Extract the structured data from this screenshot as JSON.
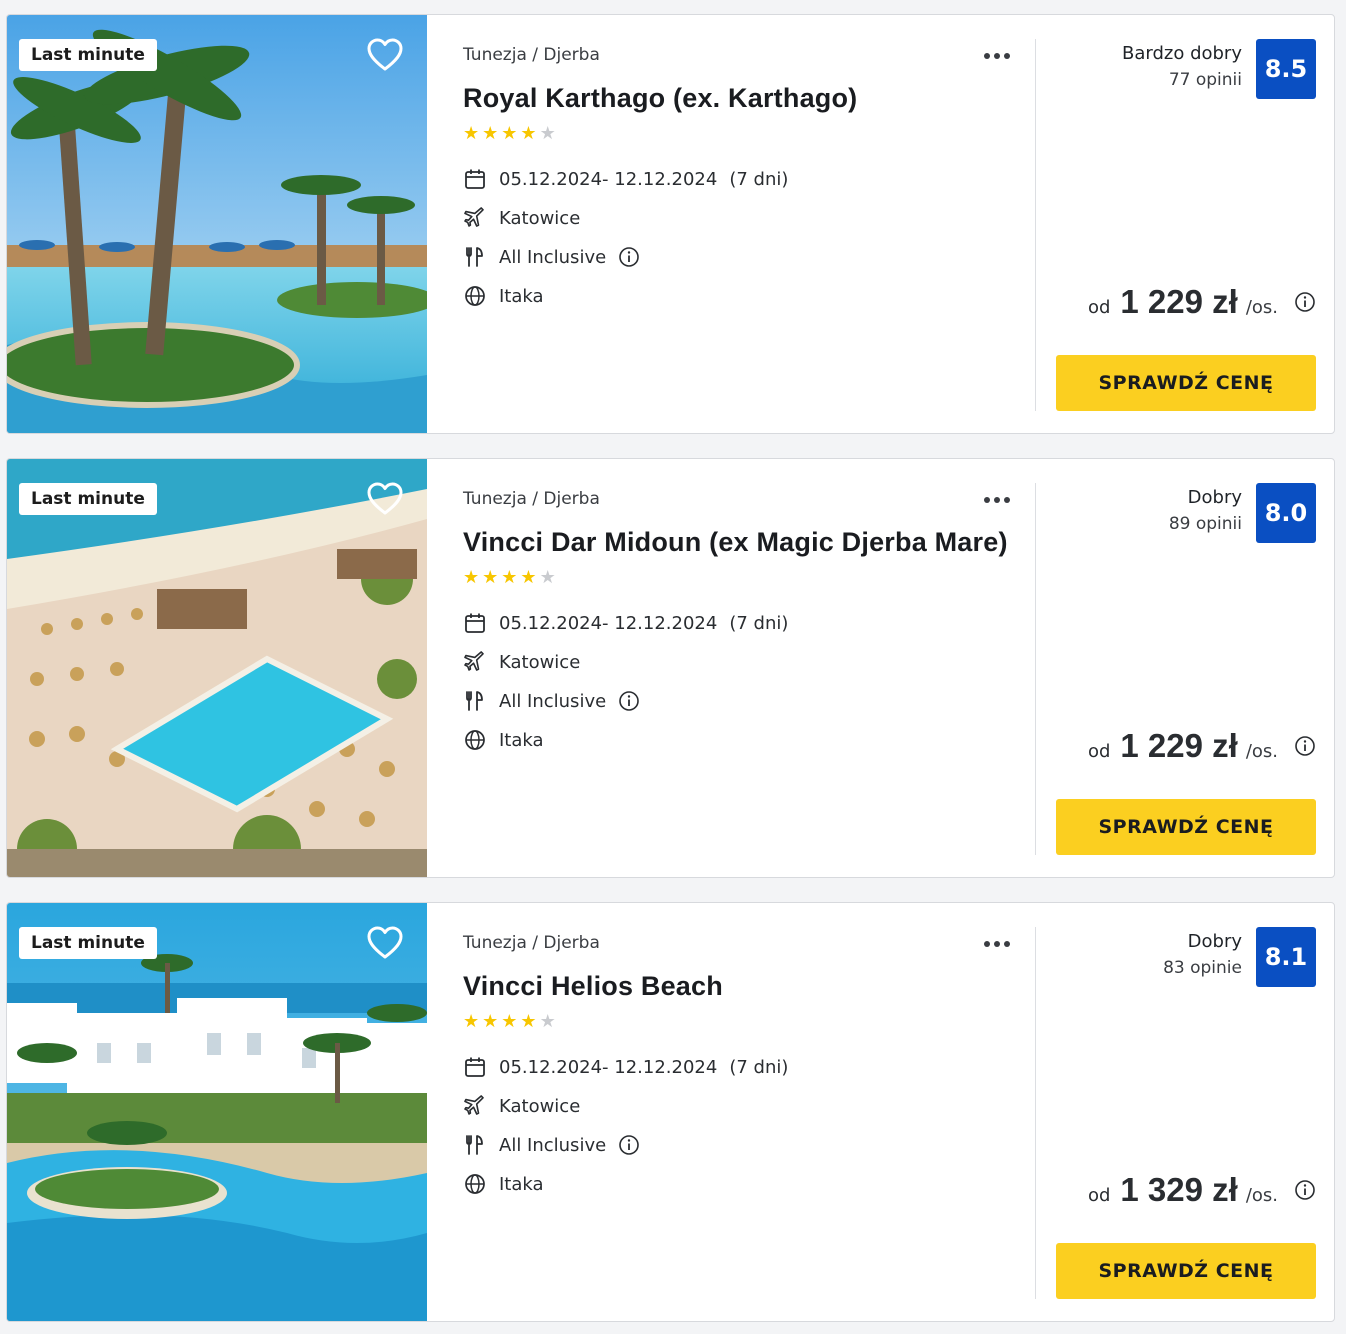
{
  "colors": {
    "score_badge": "#0a4fc2",
    "cta": "#fbcf20",
    "star_on": "#f7c600",
    "star_off": "#c9cbcf"
  },
  "icons": {
    "favorite": "heart-outline-icon",
    "more": "more-dots-icon",
    "dates": "calendar-icon",
    "departure": "plane-icon",
    "board": "cutlery-icon",
    "operator": "globe-icon",
    "info": "info-circle-icon"
  },
  "offers": [
    {
      "badge": "Last minute",
      "location": "Tunezja / Djerba",
      "title": "Royal Karthago (ex. Karthago)",
      "stars": 4,
      "dates": "05.12.2024- 12.12.2024",
      "duration": "(7 dni)",
      "departure": "Katowice",
      "board": "All Inclusive",
      "operator": "Itaka",
      "rating_word": "Bardzo dobry",
      "rating_count": "77 opinii",
      "score": "8.5",
      "price_prefix": "od",
      "price": "1 229 zł",
      "price_suffix": "/os.",
      "cta": "SPRAWDŹ CENĘ"
    },
    {
      "badge": "Last minute",
      "location": "Tunezja / Djerba",
      "title": "Vincci Dar Midoun (ex Magic Djerba Mare)",
      "stars": 4,
      "dates": "05.12.2024- 12.12.2024",
      "duration": "(7 dni)",
      "departure": "Katowice",
      "board": "All Inclusive",
      "operator": "Itaka",
      "rating_word": "Dobry",
      "rating_count": "89 opinii",
      "score": "8.0",
      "price_prefix": "od",
      "price": "1 229 zł",
      "price_suffix": "/os.",
      "cta": "SPRAWDŹ CENĘ"
    },
    {
      "badge": "Last minute",
      "location": "Tunezja / Djerba",
      "title": "Vincci Helios Beach",
      "stars": 4,
      "dates": "05.12.2024- 12.12.2024",
      "duration": "(7 dni)",
      "departure": "Katowice",
      "board": "All Inclusive",
      "operator": "Itaka",
      "rating_word": "Dobry",
      "rating_count": "83 opinie",
      "score": "8.1",
      "price_prefix": "od",
      "price": "1 329 zł",
      "price_suffix": "/os.",
      "cta": "SPRAWDŹ CENĘ"
    }
  ]
}
